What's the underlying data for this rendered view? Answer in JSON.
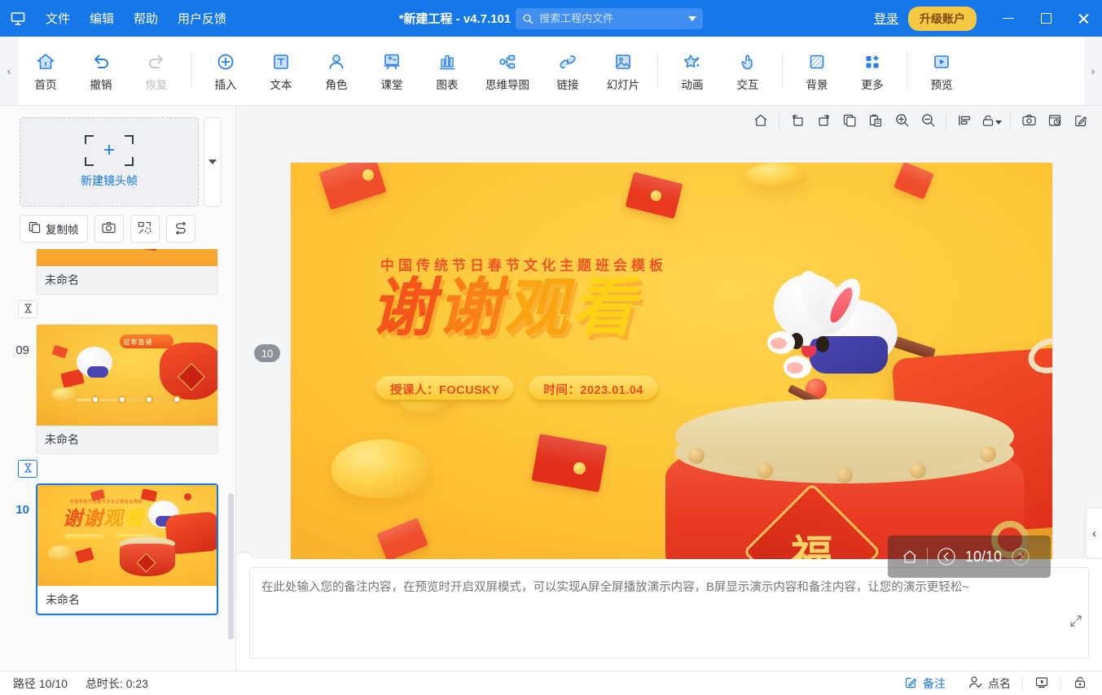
{
  "titlebar": {
    "logo_icon": "app-logo-icon",
    "menus": [
      {
        "label": "文件",
        "name": "menu-file"
      },
      {
        "label": "编辑",
        "name": "menu-edit"
      },
      {
        "label": "帮助",
        "name": "menu-help"
      },
      {
        "label": "用户反馈",
        "name": "menu-feedback"
      }
    ],
    "project_title": "*新建工程 - v4.7.101",
    "search": {
      "placeholder": "搜索工程内文件",
      "value": "",
      "icon": "search-icon",
      "caret_icon": "chevron-down-icon"
    },
    "login_label": "登录",
    "upgrade_label": "升级账户",
    "upgrade_color": "#f6c944",
    "window_buttons": {
      "minimize": "minimize-icon",
      "maximize": "maximize-icon",
      "close": "close-icon"
    },
    "accent_color": "#1677e8"
  },
  "ribbon": {
    "scroll_left_icon": "chevron-left-icon",
    "scroll_right_icon": "chevron-right-icon",
    "items": [
      {
        "label": "首页",
        "name": "ribbon-home",
        "icon": "home-icon",
        "disabled": false
      },
      {
        "label": "撤销",
        "name": "ribbon-undo",
        "icon": "undo-icon",
        "disabled": false
      },
      {
        "label": "恢复",
        "name": "ribbon-redo",
        "icon": "redo-icon",
        "disabled": true
      },
      {
        "label": "插入",
        "name": "ribbon-insert",
        "icon": "plus-circle-icon",
        "disabled": false
      },
      {
        "label": "文本",
        "name": "ribbon-text",
        "icon": "text-box-icon",
        "disabled": false
      },
      {
        "label": "角色",
        "name": "ribbon-character",
        "icon": "person-icon",
        "disabled": false
      },
      {
        "label": "课堂",
        "name": "ribbon-classroom",
        "icon": "whiteboard-icon",
        "disabled": false
      },
      {
        "label": "图表",
        "name": "ribbon-chart",
        "icon": "bar-chart-icon",
        "disabled": false
      },
      {
        "label": "思维导图",
        "name": "ribbon-mindmap",
        "icon": "mindmap-icon",
        "disabled": false
      },
      {
        "label": "链接",
        "name": "ribbon-link",
        "icon": "link-icon",
        "disabled": false
      },
      {
        "label": "幻灯片",
        "name": "ribbon-slide",
        "icon": "image-slide-icon",
        "disabled": false
      },
      {
        "label": "动画",
        "name": "ribbon-animation",
        "icon": "star-sparkle-icon",
        "disabled": false
      },
      {
        "label": "交互",
        "name": "ribbon-interaction",
        "icon": "hand-tap-icon",
        "disabled": false
      },
      {
        "label": "背景",
        "name": "ribbon-background",
        "icon": "hatched-square-icon",
        "disabled": false
      },
      {
        "label": "更多",
        "name": "ribbon-more",
        "icon": "grid-dots-icon",
        "disabled": false
      },
      {
        "label": "预览",
        "name": "ribbon-preview",
        "icon": "play-box-icon",
        "disabled": false
      }
    ]
  },
  "leftpanel": {
    "new_frame_label": "新建镜头帧",
    "new_frame_icon": "target-plus-icon",
    "new_frame_dropdown_icon": "chevron-down-icon",
    "tools": [
      {
        "label": "复制帧",
        "name": "duplicate-frame-button",
        "icon": "copy-icon"
      },
      {
        "label": "",
        "name": "snapshot-frame-button",
        "icon": "camera-icon"
      },
      {
        "label": "",
        "name": "fit-frame-button",
        "icon": "scatter-path-icon"
      },
      {
        "label": "",
        "name": "reorder-frames-button",
        "icon": "swap-path-icon"
      }
    ],
    "frames": [
      {
        "number": "",
        "name": "未命名",
        "selected": false,
        "partial": true
      },
      {
        "number": "09",
        "name": "未命名",
        "selected": false,
        "partial": false
      },
      {
        "number": "10",
        "name": "未命名",
        "selected": true,
        "partial": false
      }
    ],
    "timer_icon": "hourglass-icon"
  },
  "canvas_toolbar": {
    "buttons": [
      {
        "name": "canvas-home-button",
        "icon": "home-outline-icon"
      },
      {
        "name": "rotate-left-button",
        "icon": "rotate-left-icon"
      },
      {
        "name": "rotate-right-button",
        "icon": "rotate-right-icon"
      },
      {
        "name": "copy-button",
        "icon": "copy-outline-icon"
      },
      {
        "name": "paste-button",
        "icon": "paste-icon"
      },
      {
        "name": "zoom-in-button",
        "icon": "zoom-in-icon"
      },
      {
        "name": "zoom-out-button",
        "icon": "zoom-out-icon"
      },
      {
        "name": "align-button",
        "icon": "align-left-icon"
      },
      {
        "name": "lock-button",
        "icon": "unlock-icon"
      },
      {
        "name": "screenshot-button",
        "icon": "camera-outline-icon"
      },
      {
        "name": "history-button",
        "icon": "history-box-icon"
      },
      {
        "name": "edit-button",
        "icon": "edit-square-icon"
      }
    ]
  },
  "slide": {
    "badge": "10",
    "subtitle": "中国传统节日春节文化主题班会模板",
    "title_chars": [
      {
        "char": "谢",
        "color": "#f4551a"
      },
      {
        "char": "谢",
        "color": "#f98019"
      },
      {
        "char": "观",
        "color": "#f9a513"
      },
      {
        "char": "看",
        "color": "#ffd217"
      }
    ],
    "pills": [
      {
        "text": "授课人：FOCUSKY",
        "name": "presenter-pill"
      },
      {
        "text": "时间：2023.01.04",
        "name": "date-pill"
      }
    ],
    "fu_char": "福",
    "nav": {
      "home_icon": "home-outline-icon",
      "prev_icon": "chevron-left-circle-icon",
      "next_icon": "chevron-right-circle-icon",
      "counter": "10/10"
    },
    "collapse_left_icon": "chevron-left-icon",
    "collapse_right_icon": "chevron-left-icon"
  },
  "notes": {
    "placeholder": "在此处输入您的备注内容，在预览时开启双屏模式，可以实现A屏全屏播放演示内容，B屏显示演示内容和备注内容，让您的演示更轻松~",
    "value": "",
    "resize_icon": "expand-diagonal-icon"
  },
  "status": {
    "path_label": "路径 10/10",
    "duration_label": "总时长: 0:23",
    "items": [
      {
        "label": "备注",
        "name": "status-notes-button",
        "icon": "notes-edit-icon",
        "active": true
      },
      {
        "label": "点名",
        "name": "status-rollcall-button",
        "icon": "person-check-icon",
        "active": false
      },
      {
        "label": "",
        "name": "status-present-button",
        "icon": "presentation-icon",
        "active": false
      },
      {
        "label": "",
        "name": "status-lock-button",
        "icon": "lock-box-icon",
        "active": false
      }
    ]
  }
}
